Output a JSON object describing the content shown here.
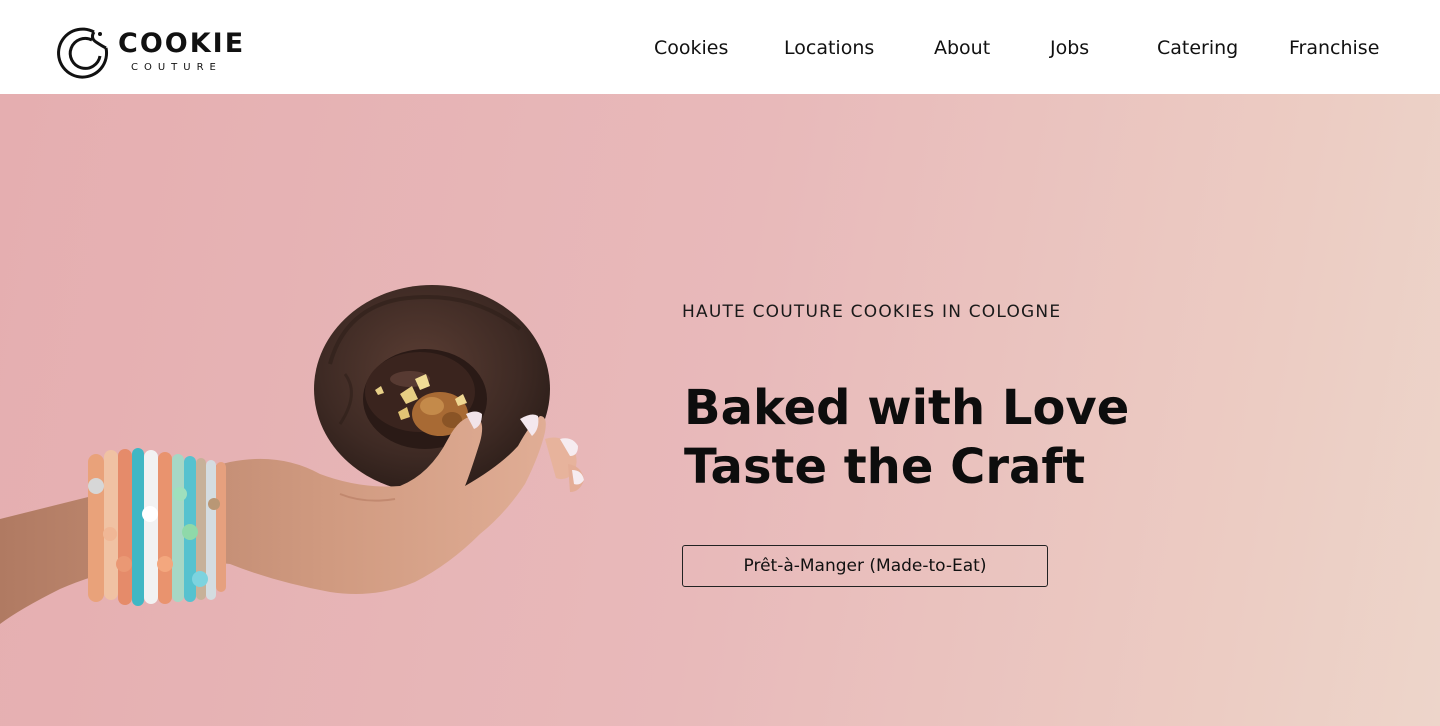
{
  "header": {
    "logo": {
      "word": "COOKIE",
      "sub": "COUTURE"
    },
    "nav": [
      "Cookies",
      "Locations",
      "About",
      "Jobs",
      "Catering",
      "Franchise"
    ]
  },
  "hero": {
    "eyebrow": "HAUTE COUTURE COOKIES IN COLOGNE",
    "headline_line1": "Baked with Love",
    "headline_line2": "Taste the Craft",
    "cta_label": "Prêt-à-Manger (Made-to-Eat)"
  },
  "colors": {
    "hero_gradient_start": "#e5aeb0",
    "hero_gradient_end": "#edd5ca",
    "text_primary": "#111111",
    "header_bg": "#ffffff"
  },
  "icons": {
    "logo_mark": "cookie-bite-logo-icon"
  }
}
